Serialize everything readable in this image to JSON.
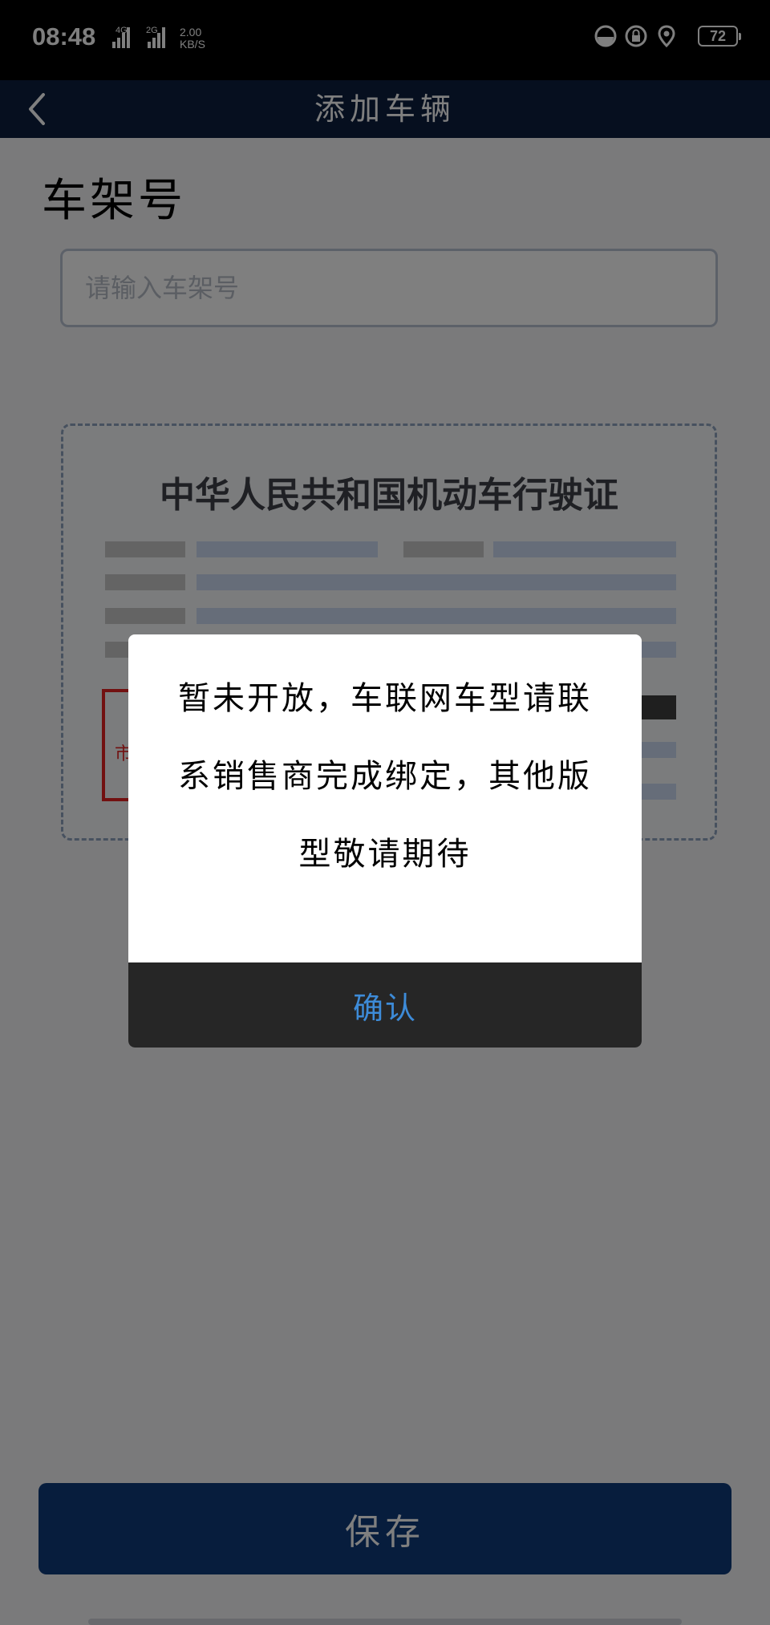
{
  "status_bar": {
    "time": "08:48",
    "network_1": "4G",
    "network_2": "2G",
    "speed_value": "2.00",
    "speed_unit": "KB/S",
    "battery": "72",
    "icons": [
      "data-saver-icon",
      "lock-icon",
      "location-icon"
    ]
  },
  "header": {
    "title": "添加车辆",
    "back_icon": "chevron-left-icon"
  },
  "form": {
    "section_title": "车架号",
    "vin_placeholder": "请输入车架号",
    "license_card_title": "中华人民共和国机动车行驶证",
    "stamp_text": "市通"
  },
  "footer": {
    "save_label": "保存"
  },
  "dialog": {
    "message": "暂未开放，车联网车型请联系销售商完成绑定，其他版型敬请期待",
    "confirm_label": "确认"
  },
  "colors": {
    "nav_bar": "#0c1e3f",
    "save_button": "#0f3b7b",
    "dialog_confirm_text": "#3d8bd8",
    "stamp_red": "#e42222"
  }
}
